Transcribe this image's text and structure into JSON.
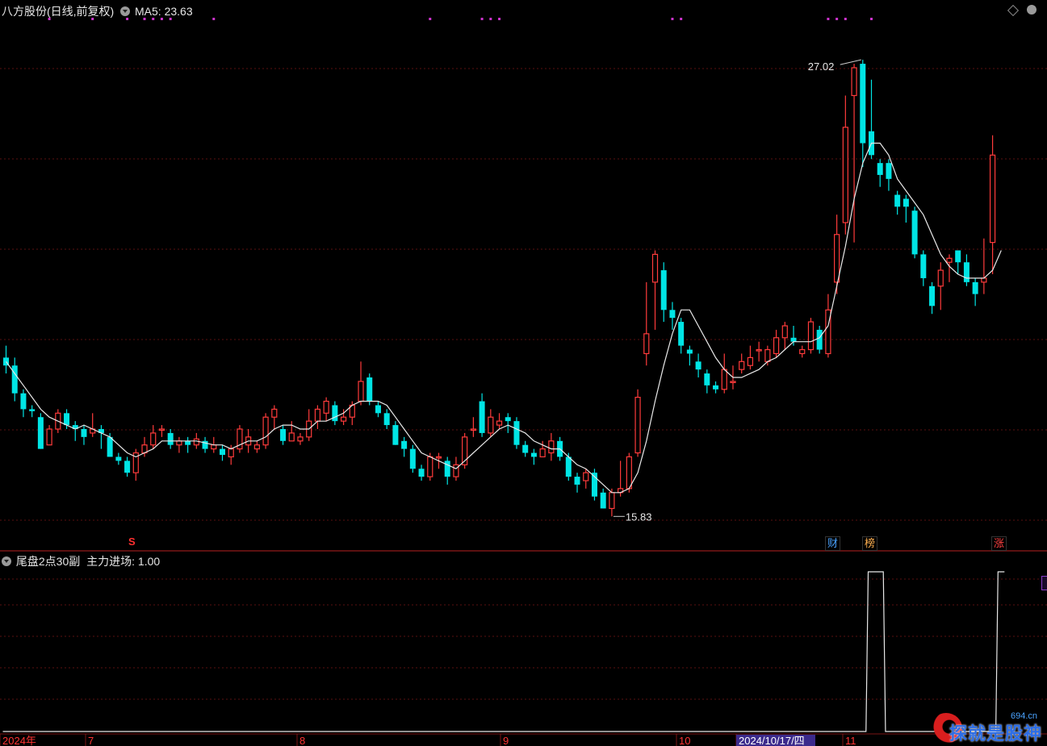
{
  "header": {
    "title": "八方股份(日线,前复权)",
    "ma_label": "MA5: 23.63"
  },
  "indicator": {
    "title": "尾盘2点30副",
    "series_label": "主力进场: 1.00"
  },
  "tags": {
    "cai": "财",
    "bang": "榜",
    "zhang": "涨",
    "s_mark": "S"
  },
  "colors": {
    "up": "#ff3b3b",
    "down": "#00e5e5",
    "ma": "#e8e8e8",
    "grid": "#5a0f0f",
    "signal_dot": "#cc33cc",
    "axis_text": "#ff3333",
    "highlight_bg": "#3b2a8c"
  },
  "watermark": {
    "text": "探就是股神",
    "site": "694.cn"
  },
  "chart_data": [
    {
      "type": "candlestick",
      "title": "八方股份(日线,前复权)",
      "ylim": [
        15.0,
        28.0
      ],
      "x_labels": [
        "2024年",
        "7",
        "8",
        "9",
        "10",
        "2024/10/17/四",
        "11"
      ],
      "annotations": {
        "high": "27.02",
        "low": "15.83"
      },
      "ma5_last": 23.63,
      "candles": [
        [
          19.4,
          19.2,
          19.7,
          19.0
        ],
        [
          19.2,
          18.5,
          19.4,
          18.3
        ],
        [
          18.5,
          18.1,
          18.6,
          17.9
        ],
        [
          18.1,
          18.05,
          18.2,
          17.9
        ],
        [
          17.9,
          17.1,
          18.0,
          17.1
        ],
        [
          17.2,
          17.6,
          17.7,
          17.2
        ],
        [
          17.6,
          18.0,
          18.1,
          17.5
        ],
        [
          18.0,
          17.7,
          18.1,
          17.6
        ],
        [
          17.7,
          17.6,
          17.8,
          17.3
        ],
        [
          17.6,
          17.4,
          17.7,
          17.2
        ],
        [
          17.5,
          17.6,
          18.0,
          17.4
        ],
        [
          17.6,
          17.5,
          17.7,
          17.1
        ],
        [
          17.4,
          16.9,
          17.5,
          16.9
        ],
        [
          16.9,
          16.8,
          17.0,
          16.7
        ],
        [
          16.8,
          16.5,
          16.9,
          16.4
        ],
        [
          16.5,
          17.0,
          17.1,
          16.3
        ],
        [
          17.0,
          17.2,
          17.4,
          16.9
        ],
        [
          17.2,
          17.5,
          17.7,
          17.1
        ],
        [
          17.6,
          17.6,
          17.7,
          17.4
        ],
        [
          17.5,
          17.2,
          17.6,
          17.1
        ],
        [
          17.2,
          17.3,
          17.4,
          17.0
        ],
        [
          17.3,
          17.2,
          17.4,
          17.0
        ],
        [
          17.2,
          17.35,
          17.5,
          17.1
        ],
        [
          17.3,
          17.1,
          17.4,
          17.0
        ],
        [
          17.1,
          17.2,
          17.4,
          17.0
        ],
        [
          17.1,
          16.95,
          17.2,
          16.8
        ],
        [
          16.9,
          17.1,
          17.2,
          16.7
        ],
        [
          17.1,
          17.6,
          17.7,
          17.0
        ],
        [
          17.2,
          17.4,
          17.6,
          17.0
        ],
        [
          17.1,
          17.2,
          17.3,
          17.0
        ],
        [
          17.2,
          17.9,
          18.0,
          17.1
        ],
        [
          17.9,
          18.1,
          18.2,
          17.6
        ],
        [
          17.6,
          17.3,
          17.7,
          17.2
        ],
        [
          17.3,
          17.5,
          17.8,
          17.3
        ],
        [
          17.3,
          17.4,
          17.5,
          17.2
        ],
        [
          17.4,
          17.8,
          18.1,
          17.3
        ],
        [
          17.8,
          18.1,
          18.2,
          17.6
        ],
        [
          18.0,
          18.3,
          18.4,
          17.8
        ],
        [
          18.2,
          17.8,
          18.3,
          17.7
        ],
        [
          17.8,
          17.9,
          18.1,
          17.7
        ],
        [
          17.9,
          18.2,
          18.3,
          17.7
        ],
        [
          18.3,
          18.8,
          19.3,
          18.2
        ],
        [
          18.9,
          18.3,
          19.0,
          18.2
        ],
        [
          18.2,
          18.0,
          18.3,
          17.9
        ],
        [
          18.0,
          17.7,
          18.1,
          17.6
        ],
        [
          17.7,
          17.2,
          17.8,
          17.2
        ],
        [
          17.3,
          17.1,
          17.4,
          16.9
        ],
        [
          17.1,
          16.6,
          17.2,
          16.5
        ],
        [
          16.6,
          16.4,
          16.7,
          16.3
        ],
        [
          16.4,
          16.9,
          17.0,
          16.3
        ],
        [
          16.9,
          16.9,
          17.0,
          16.6
        ],
        [
          16.8,
          16.4,
          16.9,
          16.2
        ],
        [
          16.4,
          16.7,
          16.9,
          16.3
        ],
        [
          16.7,
          17.4,
          17.5,
          16.6
        ],
        [
          17.6,
          17.6,
          17.9,
          17.4
        ],
        [
          18.3,
          17.5,
          18.5,
          17.4
        ],
        [
          17.5,
          17.9,
          18.1,
          17.4
        ],
        [
          17.7,
          17.8,
          18.0,
          17.6
        ],
        [
          17.9,
          17.8,
          18.0,
          17.5
        ],
        [
          17.8,
          17.2,
          17.9,
          17.1
        ],
        [
          17.2,
          17.0,
          17.3,
          16.9
        ],
        [
          17.0,
          16.9,
          17.1,
          16.7
        ],
        [
          16.9,
          17.1,
          17.3,
          16.9
        ],
        [
          17.0,
          17.3,
          17.5,
          16.8
        ],
        [
          17.3,
          16.9,
          17.4,
          16.8
        ],
        [
          16.9,
          16.4,
          17.0,
          16.3
        ],
        [
          16.4,
          16.2,
          16.5,
          16.0
        ],
        [
          16.3,
          16.5,
          16.6,
          16.1
        ],
        [
          16.5,
          15.9,
          16.6,
          15.8
        ],
        [
          16.0,
          15.6,
          16.1,
          15.6
        ],
        [
          15.6,
          16.0,
          16.1,
          15.4
        ],
        [
          16.0,
          16.1,
          16.8,
          15.9
        ],
        [
          16.1,
          16.9,
          17.0,
          16.0
        ],
        [
          17.0,
          18.4,
          18.6,
          16.9
        ],
        [
          19.5,
          20.0,
          21.3,
          19.2
        ],
        [
          21.3,
          22.0,
          22.1,
          20.1
        ],
        [
          21.6,
          20.6,
          21.8,
          20.3
        ],
        [
          20.6,
          20.4,
          20.8,
          20.1
        ],
        [
          20.3,
          19.7,
          20.4,
          19.5
        ],
        [
          19.6,
          19.5,
          19.7,
          19.2
        ],
        [
          19.3,
          19.1,
          19.5,
          18.9
        ],
        [
          19.0,
          18.7,
          19.1,
          18.5
        ],
        [
          18.7,
          18.6,
          18.8,
          18.5
        ],
        [
          18.6,
          19.1,
          19.5,
          18.5
        ],
        [
          18.8,
          18.8,
          19.2,
          18.6
        ],
        [
          19.1,
          19.3,
          19.5,
          19.0
        ],
        [
          19.2,
          19.4,
          19.7,
          19.1
        ],
        [
          19.6,
          19.6,
          19.8,
          19.3
        ],
        [
          19.3,
          19.6,
          19.7,
          19.2
        ],
        [
          19.5,
          19.9,
          20.1,
          19.4
        ],
        [
          19.9,
          20.2,
          20.3,
          19.6
        ],
        [
          19.9,
          19.8,
          20.2,
          19.7
        ],
        [
          19.5,
          19.6,
          19.7,
          19.4
        ],
        [
          19.6,
          20.3,
          20.4,
          19.5
        ],
        [
          20.1,
          19.6,
          20.2,
          19.5
        ],
        [
          19.5,
          20.6,
          21.0,
          19.4
        ],
        [
          21.3,
          22.5,
          23.0,
          21.0
        ],
        [
          22.8,
          25.2,
          26.0,
          22.5
        ],
        [
          26.0,
          26.7,
          26.8,
          22.3
        ],
        [
          26.8,
          24.8,
          26.9,
          24.2
        ],
        [
          25.1,
          24.5,
          26.4,
          24.4
        ],
        [
          24.3,
          24.0,
          24.4,
          23.7
        ],
        [
          24.3,
          23.9,
          24.4,
          23.6
        ],
        [
          23.5,
          23.2,
          23.6,
          23.0
        ],
        [
          23.4,
          23.2,
          23.5,
          22.8
        ],
        [
          23.1,
          22.0,
          23.2,
          21.9
        ],
        [
          22.0,
          21.4,
          22.1,
          21.2
        ],
        [
          21.2,
          20.7,
          21.3,
          20.5
        ],
        [
          21.2,
          21.6,
          21.8,
          20.6
        ],
        [
          21.8,
          21.9,
          22.0,
          21.3
        ],
        [
          22.1,
          21.8,
          22.1,
          21.5
        ],
        [
          21.8,
          21.3,
          22.0,
          21.2
        ],
        [
          21.3,
          21.0,
          21.4,
          20.7
        ],
        [
          21.3,
          21.4,
          22.4,
          21.0
        ],
        [
          22.3,
          24.5,
          25.0,
          21.5
        ]
      ],
      "ma5": [
        19.3,
        19.0,
        18.7,
        18.4,
        18.1,
        17.9,
        17.8,
        17.7,
        17.6,
        17.7,
        17.6,
        17.5,
        17.4,
        17.2,
        17.0,
        16.9,
        17.0,
        17.1,
        17.3,
        17.3,
        17.3,
        17.3,
        17.3,
        17.25,
        17.2,
        17.2,
        17.1,
        17.2,
        17.3,
        17.3,
        17.4,
        17.6,
        17.7,
        17.7,
        17.6,
        17.6,
        17.8,
        17.8,
        17.9,
        18.0,
        18.2,
        18.3,
        18.3,
        18.3,
        18.2,
        17.9,
        17.6,
        17.3,
        17.0,
        16.9,
        16.8,
        16.7,
        16.6,
        16.8,
        17.0,
        17.2,
        17.4,
        17.6,
        17.7,
        17.6,
        17.5,
        17.3,
        17.2,
        17.1,
        17.1,
        16.9,
        16.7,
        16.6,
        16.4,
        16.2,
        16.0,
        16.0,
        16.1,
        16.5,
        17.3,
        18.3,
        19.2,
        20.0,
        20.6,
        20.6,
        20.2,
        19.8,
        19.4,
        19.1,
        18.9,
        18.9,
        19.0,
        19.1,
        19.3,
        19.4,
        19.6,
        19.8,
        19.8,
        19.8,
        19.9,
        20.2,
        21.2,
        22.2,
        23.4,
        24.3,
        24.8,
        24.8,
        24.5,
        23.9,
        23.6,
        23.3,
        23.0,
        22.5,
        22.0,
        21.7,
        21.5,
        21.4,
        21.4,
        21.4,
        21.6,
        22.1
      ]
    },
    {
      "type": "line",
      "title": "尾盘2点30副",
      "series": [
        {
          "name": "主力进场",
          "last": 1.0
        }
      ],
      "ylim": [
        0,
        1
      ],
      "signals": [
        {
          "from": 0,
          "to": 99,
          "value": 0
        },
        {
          "from": 100,
          "to": 101,
          "value": 1
        },
        {
          "from": 102,
          "to": 114,
          "value": 0
        },
        {
          "from": 115,
          "to": 115,
          "value": 1
        }
      ]
    }
  ]
}
